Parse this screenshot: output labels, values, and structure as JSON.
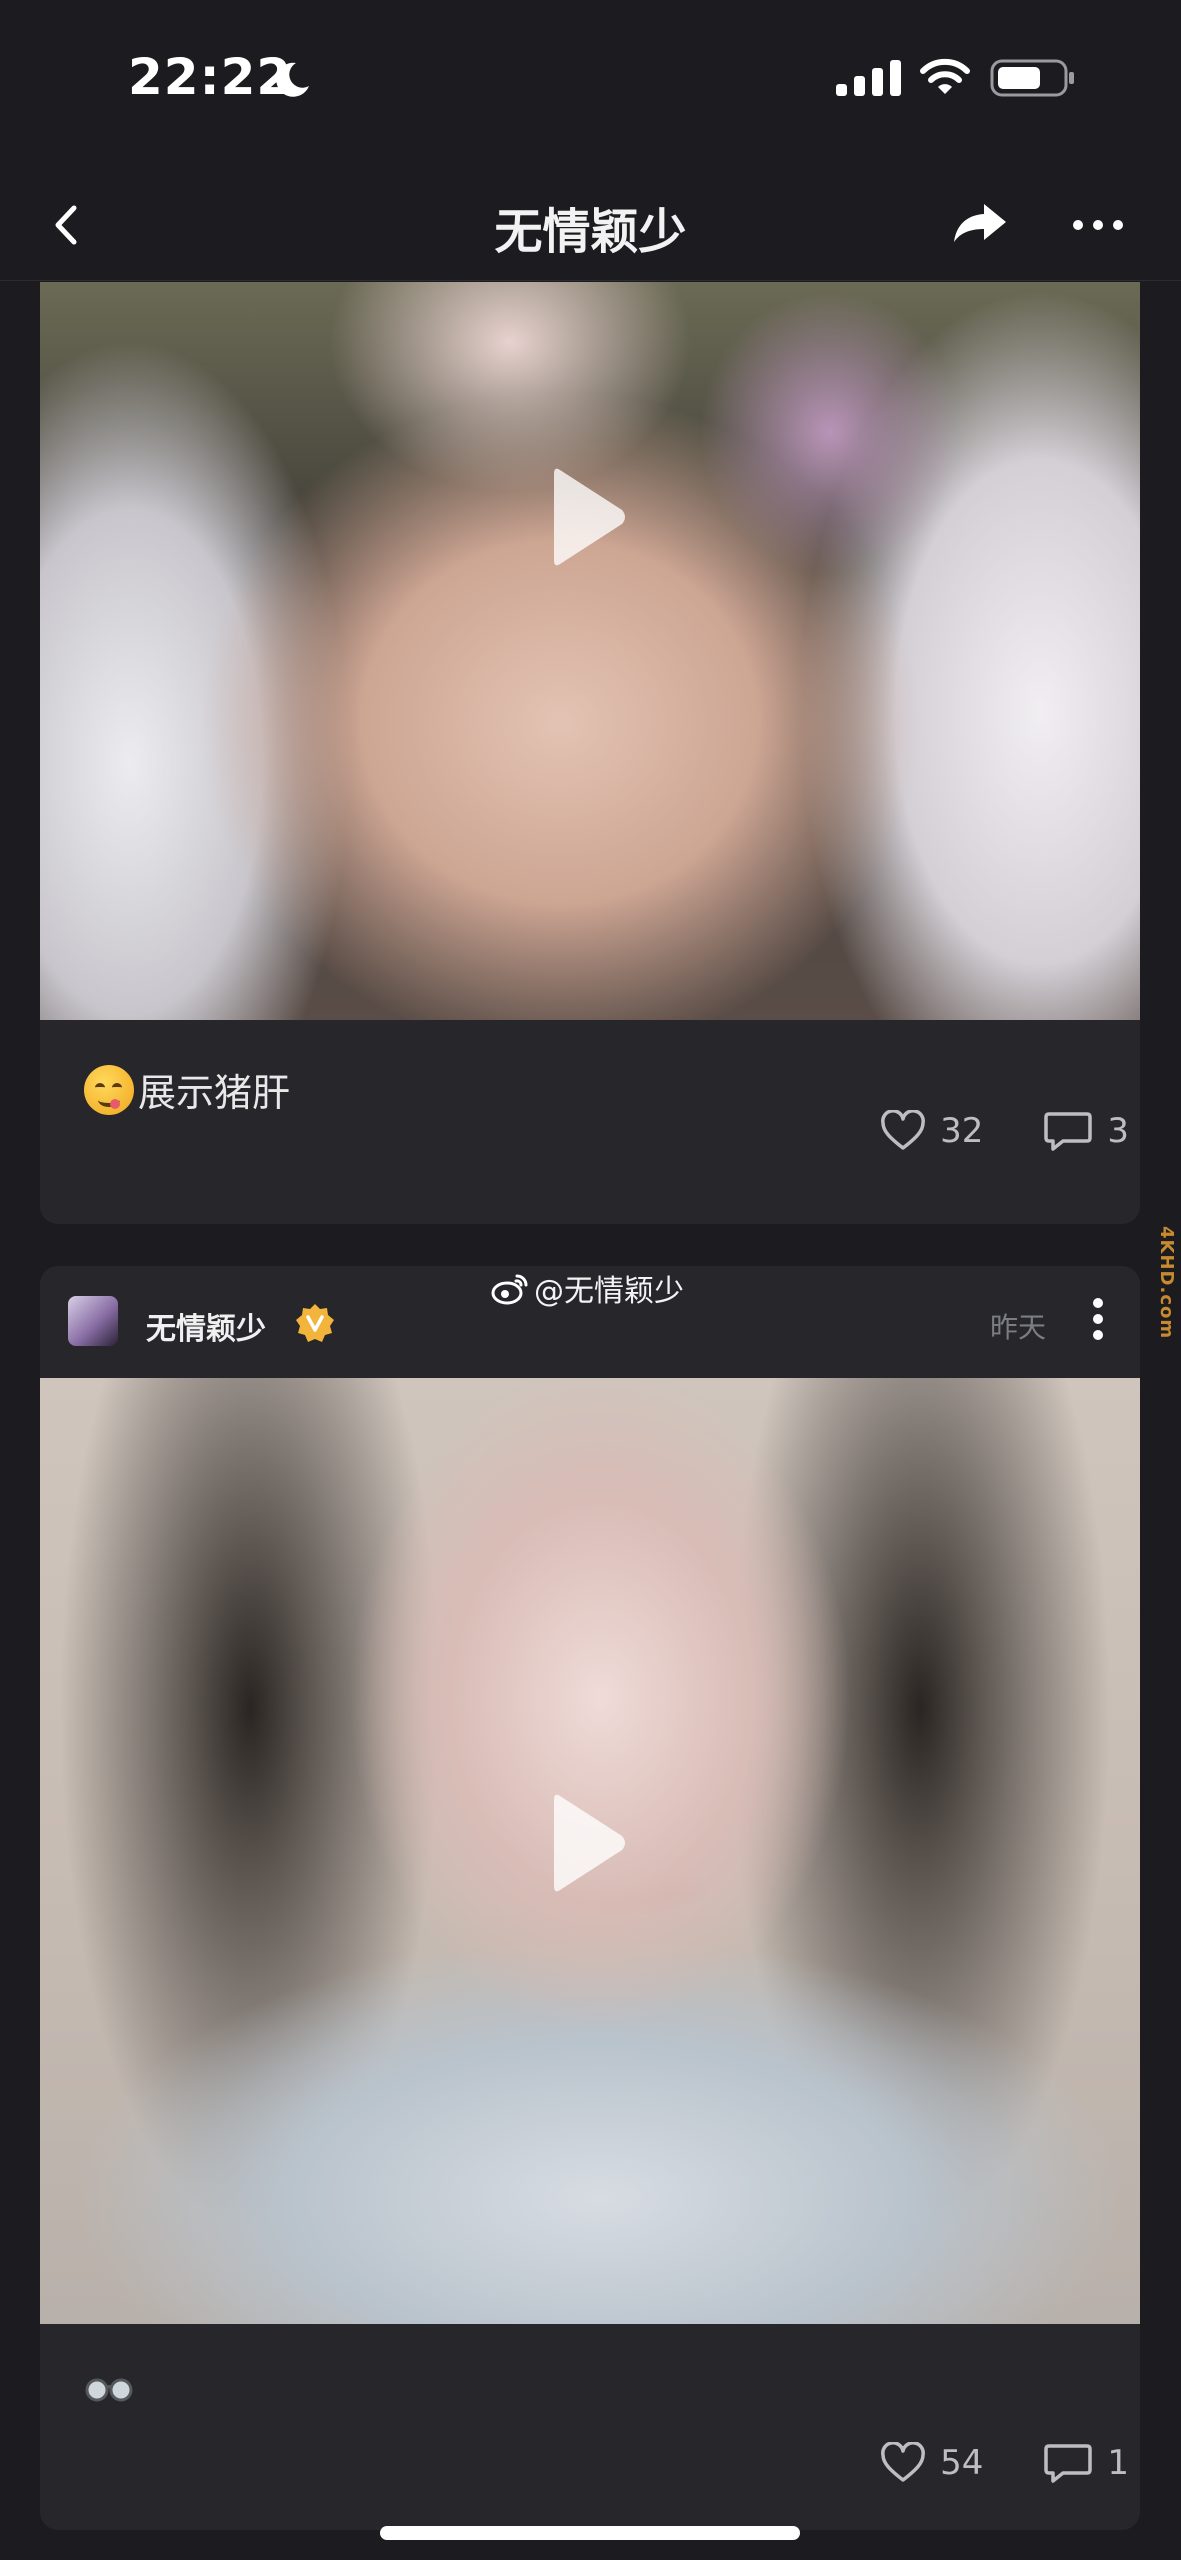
{
  "status_bar": {
    "time": "22:22"
  },
  "nav": {
    "title": "无情颖少"
  },
  "posts": [
    {
      "caption": "展示猪肝",
      "likes": "32",
      "comments": "3"
    },
    {
      "username": "无情颖少",
      "watermark": "@无情颖少",
      "time": "昨天",
      "likes": "54",
      "comments": "1"
    }
  ],
  "side_watermark": "4KHD.com",
  "colors": {
    "background": "#1c1c20",
    "card": "#26262b",
    "badge": "#f2b43a",
    "muted_text": "#7c7c84"
  }
}
